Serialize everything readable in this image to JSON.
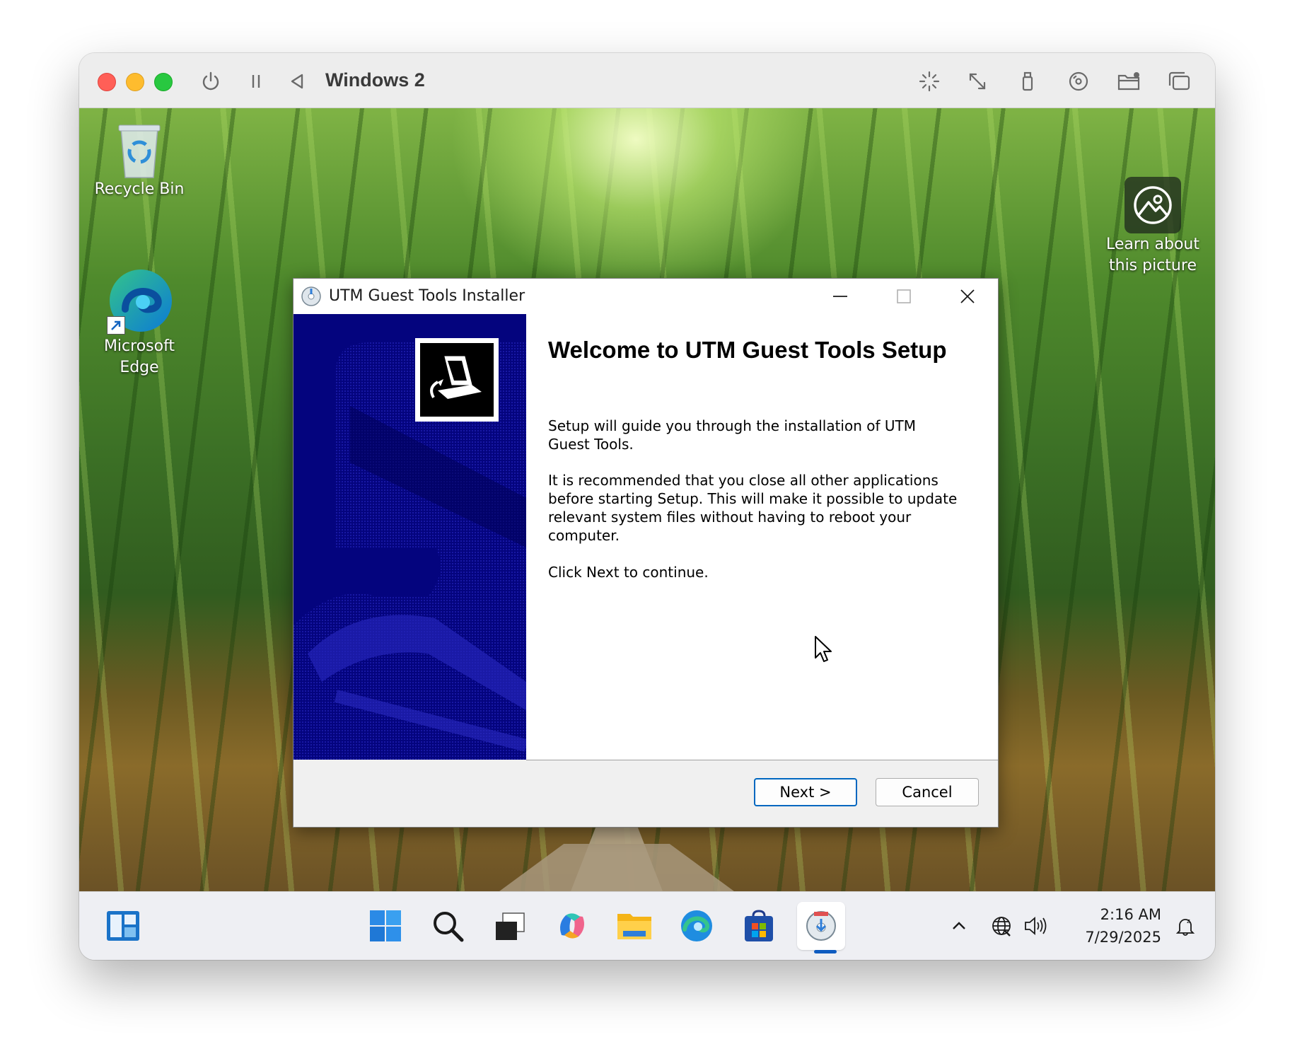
{
  "vm_window": {
    "title": "Windows 2",
    "toolbar_icons": [
      "power-icon",
      "pause-icon",
      "back-icon",
      "capture-input-icon",
      "resize-icon",
      "usb-icon",
      "cd-drive-icon",
      "shared-folder-icon",
      "windows-icon"
    ]
  },
  "desktop": {
    "icons": [
      {
        "label": "Recycle Bin",
        "icon": "recycle-bin-icon"
      },
      {
        "label": "Microsoft Edge",
        "icon": "edge-icon"
      }
    ],
    "learn_about": "Learn about this picture"
  },
  "installer": {
    "title": "UTM Guest Tools Installer",
    "heading": "Welcome to UTM Guest Tools Setup",
    "paragraph1": "Setup will guide you through the installation of UTM Guest Tools.",
    "paragraph2": "It is recommended that you close all other applications before starting Setup. This will make it possible to update relevant system files without having to reboot your computer.",
    "paragraph3": "Click Next to continue.",
    "next_label": "Next >",
    "cancel_label": "Cancel",
    "side_color": "#04047e"
  },
  "taskbar": {
    "apps": [
      "widgets-icon",
      "start-icon",
      "search-icon",
      "task-view-icon",
      "copilot-icon",
      "file-explorer-icon",
      "edge-icon",
      "store-icon",
      "utm-installer-icon"
    ],
    "active_app": "utm-installer-icon",
    "time": "2:16 AM",
    "date": "7/29/2025"
  }
}
